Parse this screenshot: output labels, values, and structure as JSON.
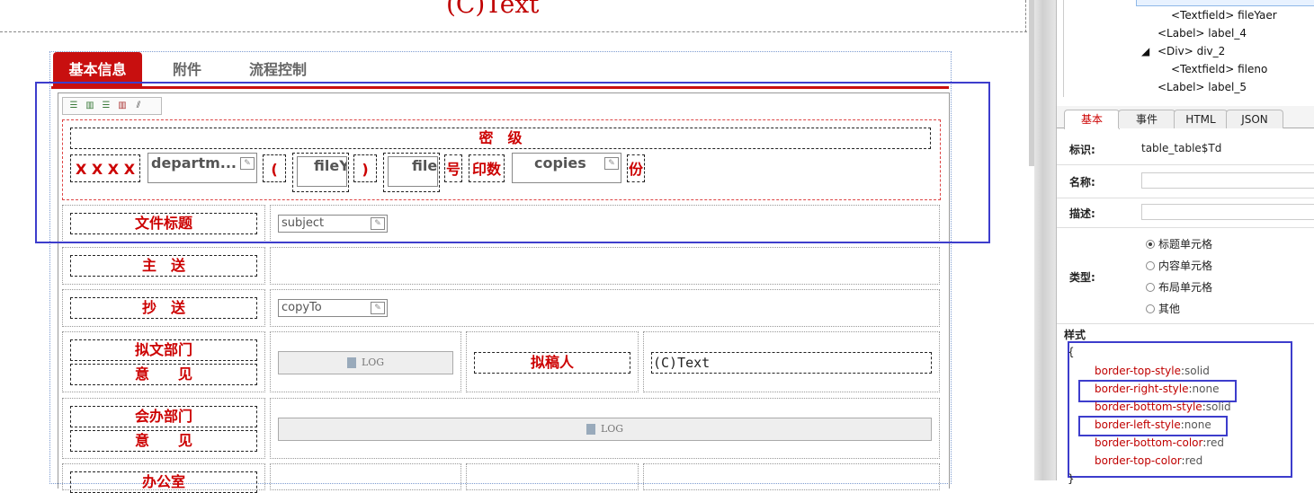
{
  "header": {
    "title": "(C)Text"
  },
  "tabs": [
    {
      "label": "基本信息"
    },
    {
      "label": "附件"
    },
    {
      "label": "流程控制"
    }
  ],
  "form": {
    "secret_label": "密　级",
    "prefix": "X X X X",
    "department_field": "departm...",
    "paren_open": "(",
    "file_year_field": "fileY",
    "paren_close": ")",
    "file_no_field": "file",
    "hao": "号",
    "print_count": "印数",
    "copies_field": "copies",
    "fen": "份",
    "title_label": "文件标题",
    "subject_field": "subject",
    "main_send_label": "主　送",
    "copy_send_label": "抄　送",
    "copy_to_field": "copyTo",
    "draft_dept_label": "拟文部门",
    "opinion_label": "意　　见",
    "log_label": "LOG",
    "drafter_label": "拟稿人",
    "drafter_value": "(C)Text",
    "co_dept_label": "会办部门",
    "opinion_label2": "意　　见",
    "log_label2": "LOG",
    "office_label": "办公室"
  },
  "tree": {
    "items": [
      {
        "text": "<Textfield> fileYaer"
      },
      {
        "text": "<Label> label_4"
      },
      {
        "text": "<Div> div_2"
      },
      {
        "text": "<Textfield> fileno"
      },
      {
        "text": "<Label> label_5"
      }
    ]
  },
  "panel": {
    "tabs": [
      "基本",
      "事件",
      "HTML",
      "JSON"
    ],
    "id_label": "标识:",
    "id_value": "table_table$Td",
    "name_label": "名称:",
    "desc_label": "描述:",
    "type_label": "类型:",
    "type_options": [
      "标题单元格",
      "内容单元格",
      "布局单元格",
      "其他"
    ],
    "type_selected": "标题单元格",
    "style_label": "样式",
    "style_open": "{",
    "style_close": "}",
    "styles": [
      {
        "prop": "border-top-style",
        "val": "solid"
      },
      {
        "prop": "border-right-style",
        "val": "none"
      },
      {
        "prop": "border-bottom-style",
        "val": "solid"
      },
      {
        "prop": "border-left-style",
        "val": "none"
      },
      {
        "prop": "border-bottom-color",
        "val": "red"
      },
      {
        "prop": "border-top-color",
        "val": "red"
      }
    ]
  }
}
